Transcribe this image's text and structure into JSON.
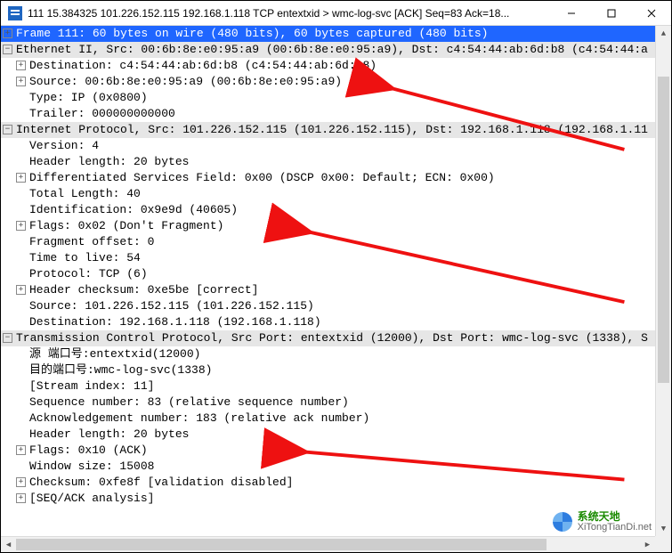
{
  "window": {
    "title": "111 15.384325 101.226.152.115 192.168.1.118 TCP entextxid > wmc-log-svc [ACK] Seq=83 Ack=18..."
  },
  "frame": {
    "summary": "Frame 111: 60 bytes on wire (480 bits), 60 bytes captured (480 bits)"
  },
  "eth": {
    "summary": "Ethernet II, Src: 00:6b:8e:e0:95:a9 (00:6b:8e:e0:95:a9), Dst: c4:54:44:ab:6d:b8 (c4:54:44:a",
    "dst": "Destination: c4:54:44:ab:6d:b8 (c4:54:44:ab:6d:b8)",
    "src": "Source: 00:6b:8e:e0:95:a9 (00:6b:8e:e0:95:a9)",
    "type": "Type: IP (0x0800)",
    "trailer": "Trailer: 000000000000"
  },
  "ip": {
    "summary": "Internet Protocol, Src: 101.226.152.115 (101.226.152.115), Dst: 192.168.1.118 (192.168.1.11",
    "version": "Version: 4",
    "hlen": "Header length: 20 bytes",
    "dsf": "Differentiated Services Field: 0x00 (DSCP 0x00: Default; ECN: 0x00)",
    "tlen": "Total Length: 40",
    "id": "Identification: 0x9e9d (40605)",
    "flags": "Flags: 0x02 (Don't Fragment)",
    "frag": "Fragment offset: 0",
    "ttl": "Time to live: 54",
    "proto": "Protocol: TCP (6)",
    "chk": "Header checksum: 0xe5be [correct]",
    "src": "Source: 101.226.152.115 (101.226.152.115)",
    "dst": "Destination: 192.168.1.118 (192.168.1.118)"
  },
  "tcp": {
    "summary": "Transmission Control Protocol, Src Port: entextxid (12000), Dst Port: wmc-log-svc (1338), S",
    "srcport": "源  端口号:entextxid(12000)",
    "dstport": "目的端口号:wmc-log-svc(1338)",
    "stream": "[Stream index: 11]",
    "seq": "Sequence number: 83    (relative sequence number)",
    "ack": "Acknowledgement number: 183    (relative ack number)",
    "hlen": "Header length: 20 bytes",
    "flags": "Flags: 0x10 (ACK)",
    "win": "Window size: 15008",
    "chk": "Checksum: 0xfe8f [validation disabled]",
    "seqack": "[SEQ/ACK analysis]"
  },
  "watermark": {
    "cn": "系统天地",
    "url": "XiTongTianDi.net"
  }
}
